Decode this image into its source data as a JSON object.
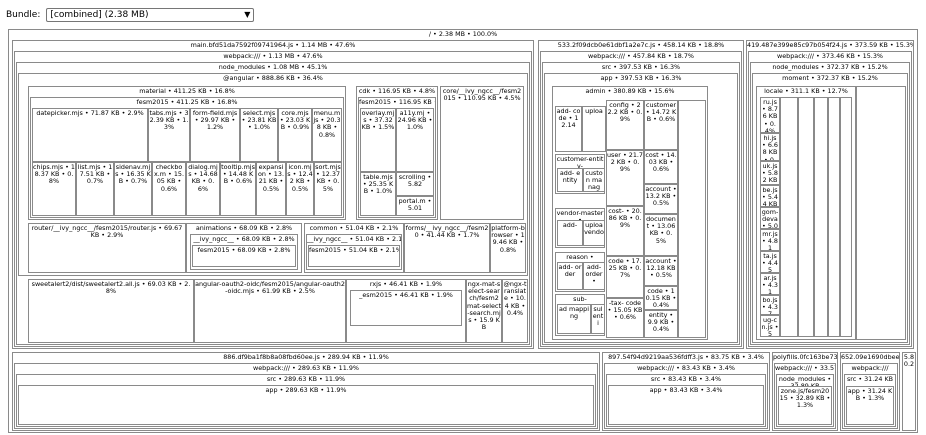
{
  "toolbar": {
    "bundle_label": "Bundle:",
    "bundle_value": "[combined] (2.38 MB)"
  },
  "root": "/ • 2.38 MB • 100.0%",
  "main": {
    "chunk": "main.bfd51da7592f09741964.js • 1.14 MB • 47.6%",
    "webpack": "webpack:/// • 1.13 MB • 47.6%",
    "node_modules": "node_modules • 1.08 MB • 45.1%",
    "angular": "@angular • 888.86 KB • 36.4%",
    "material": "material • 411.25 KB • 16.8%",
    "material_fesm": "fesm2015 • 411.25 KB • 16.8%",
    "datepicker": "datepicker.mjs • 71.87 KB • 2.9%",
    "tabs": "tabs.mjs • 32.39 KB • 1.3%",
    "formfield": "form-field.mjs • 29.97 KB • 1.2%",
    "select": "select.mjs • 23.81 KB • 1.0%",
    "core_mjs": "core.mjs • 23.03 KB • 0.9%",
    "menu": "menu.mjs • 20.38 KB • 0.8%",
    "chips": "chips.mjs • 18.37 KB • 0.8%",
    "list": "list.mjs • 17.51 KB • 0.7%",
    "sidenav": "sidenav.mjs • 16.35 KB • 0.7%",
    "checkbox": "checkbox.m • 15.05 KB • 0.6%",
    "dialog": "dialog.mjs • 14.68 KB • 0.6%",
    "tooltip": "tooltip.mjs • 14.48 KB • 0.6%",
    "expansion": "expansion • 13.21 KB • 0.5%",
    "icon": "icon.mjs • 12.42 KB • 0.5%",
    "sort": "sort.mjs • 12.37 KB • 0.5%",
    "cdk": "cdk • 116.95 KB • 4.8%",
    "cdk_fesm": "fesm2015 • 116.95 KB • 4.8%",
    "overlay": "overlay.mjs • 37.32 KB • 1.5%",
    "a11y": "a11y.mj • 24.96 KB • 1.0%",
    "table": "table.mjs • 25.35 KB • 1.0%",
    "scrolling": "scrolling • 5.82",
    "portal": "portal.m • 5.01",
    "core_ivy": "core/__ivy_ngcc__/fesm2015 • 110.95 KB • 4.5%",
    "router": "router/__ivy_ngcc__/fesm2015/router.js • 69.67 KB • 2.9%",
    "animations": "animations • 68.09 KB • 2.8%",
    "anim_ivy": "__ivy_ngcc__ • 68.09 KB • 2.8%",
    "anim_fesm": "fesm2015 • 68.09 KB • 2.8%",
    "common": "common • 51.04 KB • 2.1%",
    "common_ivy": "__ivy_ngcc__ • 51.04 KB • 2.1%",
    "common_fesm": "fesm2015 • 51.04 KB • 2.1%",
    "forms": "forms/__ivy_ngcc__/fesm20 • 41.44 KB • 1.7%",
    "platform": "platform-browser • 19.46 KB • 0.8%",
    "sweetalert": "sweetalert2/dist/sweetalert2.all.js • 69.03 KB • 2.8%",
    "oauth": "angular-oauth2-oidc/fesm2015/angular-oauth2-oidc.mjs • 61.99 KB • 2.5%",
    "rxjs": "rxjs • 46.41 KB • 1.9%",
    "esm": "_esm2015 • 46.41 KB • 1.9%",
    "mat_select": "ngx-mat-select-search/fesm2 mat-select-search.mjs • 15.9 KB",
    "ngx_translate": "@ngx-translate • 10.4 KB • 0.4%"
  },
  "c533": {
    "chunk": "533.2f09dcb0e61dbf1a2e7c.js • 458.14 KB • 18.8%",
    "webpack": "webpack:/// • 457.84 KB • 18.7%",
    "src": "src • 397.53 KB • 16.3%",
    "app": "app • 397.53 KB • 16.3%",
    "admin": "admin • 380.89 KB • 15.6%",
    "add_code": "add- code • 12.14",
    "uploa1": "uploa",
    "config": "config • 22.2 KB • 0.9%",
    "customer": "customer • 14.72 KB • 0.6%",
    "customer_entity": "customer-entity-",
    "add_entity": "add- entity",
    "custom": "custon manag",
    "user": "user • 21.72 KB • 0.9%",
    "cost": "cost • 14.03 KB • 0.6%",
    "vendor_master": "vendor-master •",
    "add2": "add-",
    "uploa_vendo": "uploa vendo",
    "cost2": "cost- • 20.86 KB • 0.9%",
    "account1": "account • 13.2 KB • 0.5%",
    "reason": "reason •",
    "add_order": "add- order",
    "add_order2": "add- order •",
    "document": "document • 13.06 KB • 0.5%",
    "code": "code • 17.25 KB • 0.7%",
    "account2": "account • 12.18 KB • 0.5%",
    "sub": "sub-",
    "ad_mapping": "ad mapping",
    "sub_entity": "sul enti",
    "tax_code": "-tax- code • 15.05 KB • 0.6%",
    "code2": "code • 10.15 KB • 0.4%",
    "entity": "entity • 9.9 KB • 0.4%"
  },
  "c419": {
    "chunk": "419.487e399e85c97b054f24.js • 373.59 KB • 15.3%",
    "webpack": "webpack:/// • 373.46 KB • 15.3%",
    "node_modules": "node_modules • 372.37 KB • 15.2%",
    "moment": "moment • 372.37 KB • 15.2%",
    "locale": "locale • 311.1 KB • 12.7%",
    "ru": "ru.js • 8.76 KB • 0.4%",
    "hi": "hi.js • 6.68 KB • 0.3%",
    "uk": "uk.js • 5.82 KB • 0.2%",
    "be": "be.js • 5.44 KB • 0.2%",
    "gom": "gom-deva • 5.06 KB",
    "mr": "mr.js • 4.81",
    "ta": "ta.js • 4.45",
    "ar": "ar.js • 4.31",
    "bo": "bo.js • 4.37",
    "ug": "ug-cn.js • 5"
  },
  "c886": {
    "chunk": "886.df9ba1f8b8a08fbd60ee.js • 289.94 KB • 11.9%",
    "webpack": "webpack:/// • 289.63 KB • 11.9%",
    "src": "src • 289.63 KB • 11.9%",
    "app": "app • 289.63 KB • 11.9%"
  },
  "c897": {
    "chunk": "897.54f94d9219aa536fdff3.js • 83.75 KB • 3.4%",
    "webpack": "webpack:/// • 83.43 KB • 3.4%",
    "src": "src • 83.43 KB • 3.4%",
    "app": "app • 83.43 KB • 3.4%"
  },
  "polyfills": {
    "chunk": "polyfills.0fc163be73e9",
    "webpack": "webpack:/// • 33.57",
    "node_modules": "node_modules • 32.89 KB",
    "zone": "zone.js/fesm2015 • 32.89 KB • 1.3%"
  },
  "c652": {
    "chunk": "652.09e1690dbee8fe",
    "webpack": "webpack:///",
    "src": "src • 31.24 KB",
    "app": "app • 31.24 KB • 1.3%"
  },
  "c5": {
    "chunk": "5.8 0.2"
  }
}
